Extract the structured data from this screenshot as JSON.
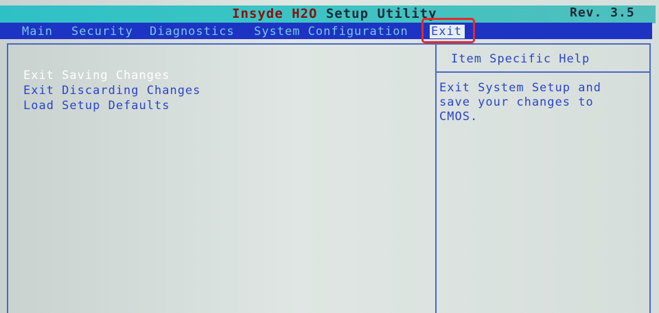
{
  "header": {
    "title_brand": "Insyde H2O",
    "title_rest": " Setup Utility",
    "revision": "Rev. 3.5"
  },
  "menu": {
    "items": [
      {
        "label": "Main"
      },
      {
        "label": "Security"
      },
      {
        "label": "Diagnostics"
      },
      {
        "label": "System Configuration"
      },
      {
        "label": "Exit"
      }
    ],
    "active": "Exit"
  },
  "main": {
    "options": [
      {
        "label": "Exit Saving Changes",
        "selected": true
      },
      {
        "label": "Exit Discarding Changes",
        "selected": false
      },
      {
        "label": "Load Setup Defaults",
        "selected": false
      }
    ]
  },
  "help": {
    "title": "Item Specific Help",
    "lines": [
      "Exit System Setup and",
      "save your changes to",
      "CMOS."
    ]
  },
  "colors": {
    "title_bar": "#3ac4c4",
    "menu_bar": "#1d33c4",
    "menu_text": "#79c8dc",
    "panel_text": "#2a44c8",
    "selected_text": "#ffffff",
    "highlight_box": "#e32a2a"
  }
}
